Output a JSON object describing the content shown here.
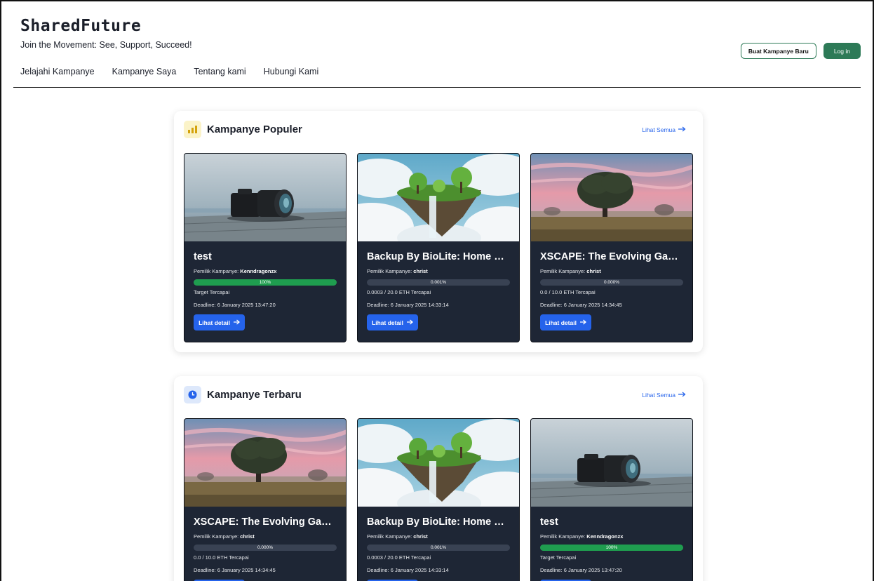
{
  "header": {
    "brand": "SharedFuture",
    "tagline": "Join the Movement: See, Support, Succeed!",
    "nav": [
      "Jelajahi Kampanye",
      "Kampanye Saya",
      "Tentang kami",
      "Hubungi Kami"
    ],
    "create_button": "Buat Kampanye Baru",
    "login_button": "Log in"
  },
  "popular": {
    "title": "Kampanye Populer",
    "see_all": "Lihat Semua",
    "cards": [
      {
        "image": "camera",
        "title": "test",
        "owner_label": "Pemilik Kampanye:",
        "owner": "Kenndragonzx",
        "progress_label": "100%",
        "progress": 1.0,
        "status": "Target Tercapai",
        "deadline": "Deadline: 6 January 2025 13:47:20",
        "button": "Lihat detail"
      },
      {
        "image": "floating-island",
        "title": "Backup By BioLite: Home En...",
        "owner_label": "Pemilik Kampanye:",
        "owner": "christ",
        "progress_label": "0.001%",
        "progress": 1e-05,
        "status": "0.0003 / 20.0 ETH Tercapai",
        "deadline": "Deadline: 6 January 2025 14:33:14",
        "button": "Lihat detail"
      },
      {
        "image": "tree-sunset",
        "title": "XSCAPE: The Evolving Game ...",
        "owner_label": "Pemilik Kampanye:",
        "owner": "christ",
        "progress_label": "0.000%",
        "progress": 0,
        "status": "0.0 / 10.0 ETH Tercapai",
        "deadline": "Deadline: 6 January 2025 14:34:45",
        "button": "Lihat detail"
      }
    ]
  },
  "latest": {
    "title": "Kampanye Terbaru",
    "see_all": "Lihat Semua",
    "cards": [
      {
        "image": "tree-sunset",
        "title": "XSCAPE: The Evolving Game ...",
        "owner_label": "Pemilik Kampanye:",
        "owner": "christ",
        "progress_label": "0.000%",
        "progress": 0,
        "status": "0.0 / 10.0 ETH Tercapai",
        "deadline": "Deadline: 6 January 2025 14:34:45",
        "button": "Lihat detail"
      },
      {
        "image": "floating-island",
        "title": "Backup By BioLite: Home En...",
        "owner_label": "Pemilik Kampanye:",
        "owner": "christ",
        "progress_label": "0.001%",
        "progress": 1e-05,
        "status": "0.0003 / 20.0 ETH Tercapai",
        "deadline": "Deadline: 6 January 2025 14:33:14",
        "button": "Lihat detail"
      },
      {
        "image": "camera",
        "title": "test",
        "owner_label": "Pemilik Kampanye:",
        "owner": "Kenndragonzx",
        "progress_label": "100%",
        "progress": 1.0,
        "status": "Target Tercapai",
        "deadline": "Deadline: 6 January 2025 13:47:20",
        "button": "Lihat detail"
      }
    ]
  },
  "icons": {
    "popular": "bar-chart-icon",
    "latest": "clock-icon",
    "see_all": "arrow-right-icon",
    "detail": "arrow-right-icon"
  },
  "colors": {
    "brand_green": "#2d7a57",
    "accent_blue": "#2563eb",
    "card_bg": "#1e2635",
    "progress_green": "#1f9d4f"
  }
}
